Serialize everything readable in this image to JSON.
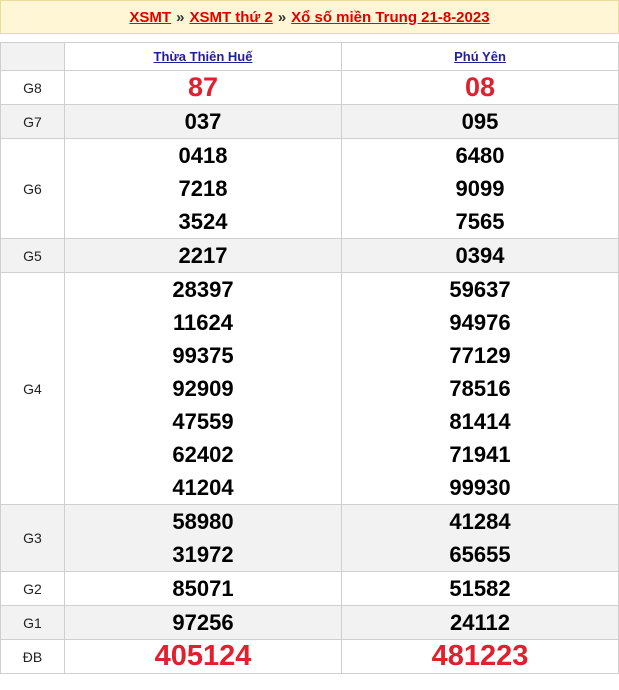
{
  "breadcrumb": {
    "link1": "XSMT",
    "sep": "»",
    "link2": "XSMT thứ 2",
    "link3": "Xổ số miền Trung 21-8-2023"
  },
  "table": {
    "provinces": [
      "Thừa Thiên Huế",
      "Phú Yên"
    ],
    "rows": [
      {
        "label": "G8",
        "values": [
          [
            "87"
          ],
          [
            "08"
          ]
        ]
      },
      {
        "label": "G7",
        "values": [
          [
            "037"
          ],
          [
            "095"
          ]
        ]
      },
      {
        "label": "G6",
        "values": [
          [
            "0418",
            "7218",
            "3524"
          ],
          [
            "6480",
            "9099",
            "7565"
          ]
        ]
      },
      {
        "label": "G5",
        "values": [
          [
            "2217"
          ],
          [
            "0394"
          ]
        ]
      },
      {
        "label": "G4",
        "values": [
          [
            "28397",
            "11624",
            "99375",
            "92909",
            "47559",
            "62402",
            "41204"
          ],
          [
            "59637",
            "94976",
            "77129",
            "78516",
            "81414",
            "71941",
            "99930"
          ]
        ]
      },
      {
        "label": "G3",
        "values": [
          [
            "58980",
            "31972"
          ],
          [
            "41284",
            "65655"
          ]
        ]
      },
      {
        "label": "G2",
        "values": [
          [
            "85071"
          ],
          [
            "51582"
          ]
        ]
      },
      {
        "label": "G1",
        "values": [
          [
            "97256"
          ],
          [
            "24112"
          ]
        ]
      },
      {
        "label": "ĐB",
        "values": [
          [
            "405124"
          ],
          [
            "481223"
          ]
        ]
      }
    ]
  },
  "colors": {
    "highlight": "#e0202e",
    "header_bg": "#fff6d5",
    "link": "#1f1f9a"
  }
}
